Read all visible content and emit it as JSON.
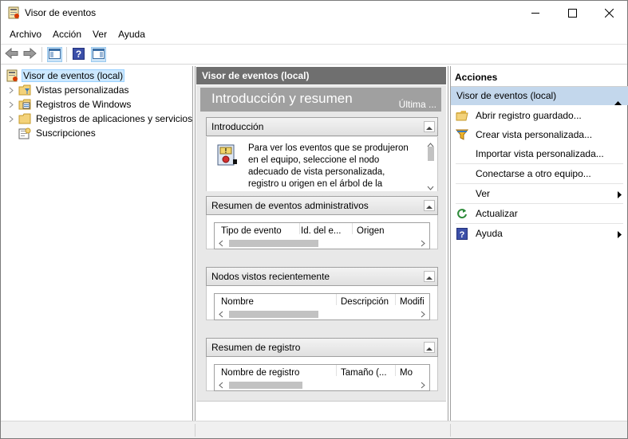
{
  "window": {
    "title": "Visor de eventos",
    "icon": "event-viewer-icon"
  },
  "menu": {
    "items": [
      "Archivo",
      "Acción",
      "Ver",
      "Ayuda"
    ]
  },
  "toolbar": {
    "buttons": [
      "back-arrow-icon",
      "forward-arrow-icon",
      "show-hide-console-tree-icon",
      "help-icon",
      "show-hide-action-pane-icon"
    ]
  },
  "tree": {
    "items": [
      {
        "label": "Visor de eventos (local)",
        "icon": "event-viewer-icon",
        "selected": true
      },
      {
        "label": "Vistas personalizadas",
        "icon": "folder-filter-icon"
      },
      {
        "label": "Registros de Windows",
        "icon": "log-folder-icon"
      },
      {
        "label": "Registros de aplicaciones y servicios",
        "icon": "folder-icon"
      },
      {
        "label": "Suscripciones",
        "icon": "subscriptions-icon"
      }
    ]
  },
  "center": {
    "header": "Visor de eventos (local)",
    "banner_title": "Introducción y resumen",
    "banner_last": "Última ...",
    "sections": {
      "intro": {
        "title": "Introducción",
        "text": "Para ver los eventos que se produjeron en el equipo, seleccione el nodo adecuado de vista personalizada, registro u origen en el árbol de la"
      },
      "admin_summary": {
        "title": "Resumen de eventos administrativos",
        "columns": [
          "Tipo de evento",
          "Id. del e...",
          "Origen"
        ]
      },
      "recent_nodes": {
        "title": "Nodos vistos recientemente",
        "columns": [
          "Nombre",
          "Descripción",
          "Modifi"
        ]
      },
      "log_summary": {
        "title": "Resumen de registro",
        "columns": [
          "Nombre de registro",
          "Tamaño (...",
          "Mo"
        ]
      }
    }
  },
  "actions": {
    "header": "Acciones",
    "group": "Visor de eventos (local)",
    "items": [
      {
        "label": "Abrir registro guardado...",
        "icon": "open-folder-icon"
      },
      {
        "label": "Crear vista personalizada...",
        "icon": "filter-icon"
      },
      {
        "label": "Importar vista personalizada...",
        "icon": ""
      },
      {
        "label": "Conectarse a otro equipo...",
        "icon": ""
      },
      {
        "label": "Ver",
        "icon": "",
        "submenu": true
      },
      {
        "label": "Actualizar",
        "icon": "refresh-icon"
      },
      {
        "label": "Ayuda",
        "icon": "help-icon",
        "submenu": true
      }
    ]
  },
  "colors": {
    "selection": "#cce8ff",
    "actions_group": "#c3d7ec",
    "center_header": "#6f6f6f"
  }
}
